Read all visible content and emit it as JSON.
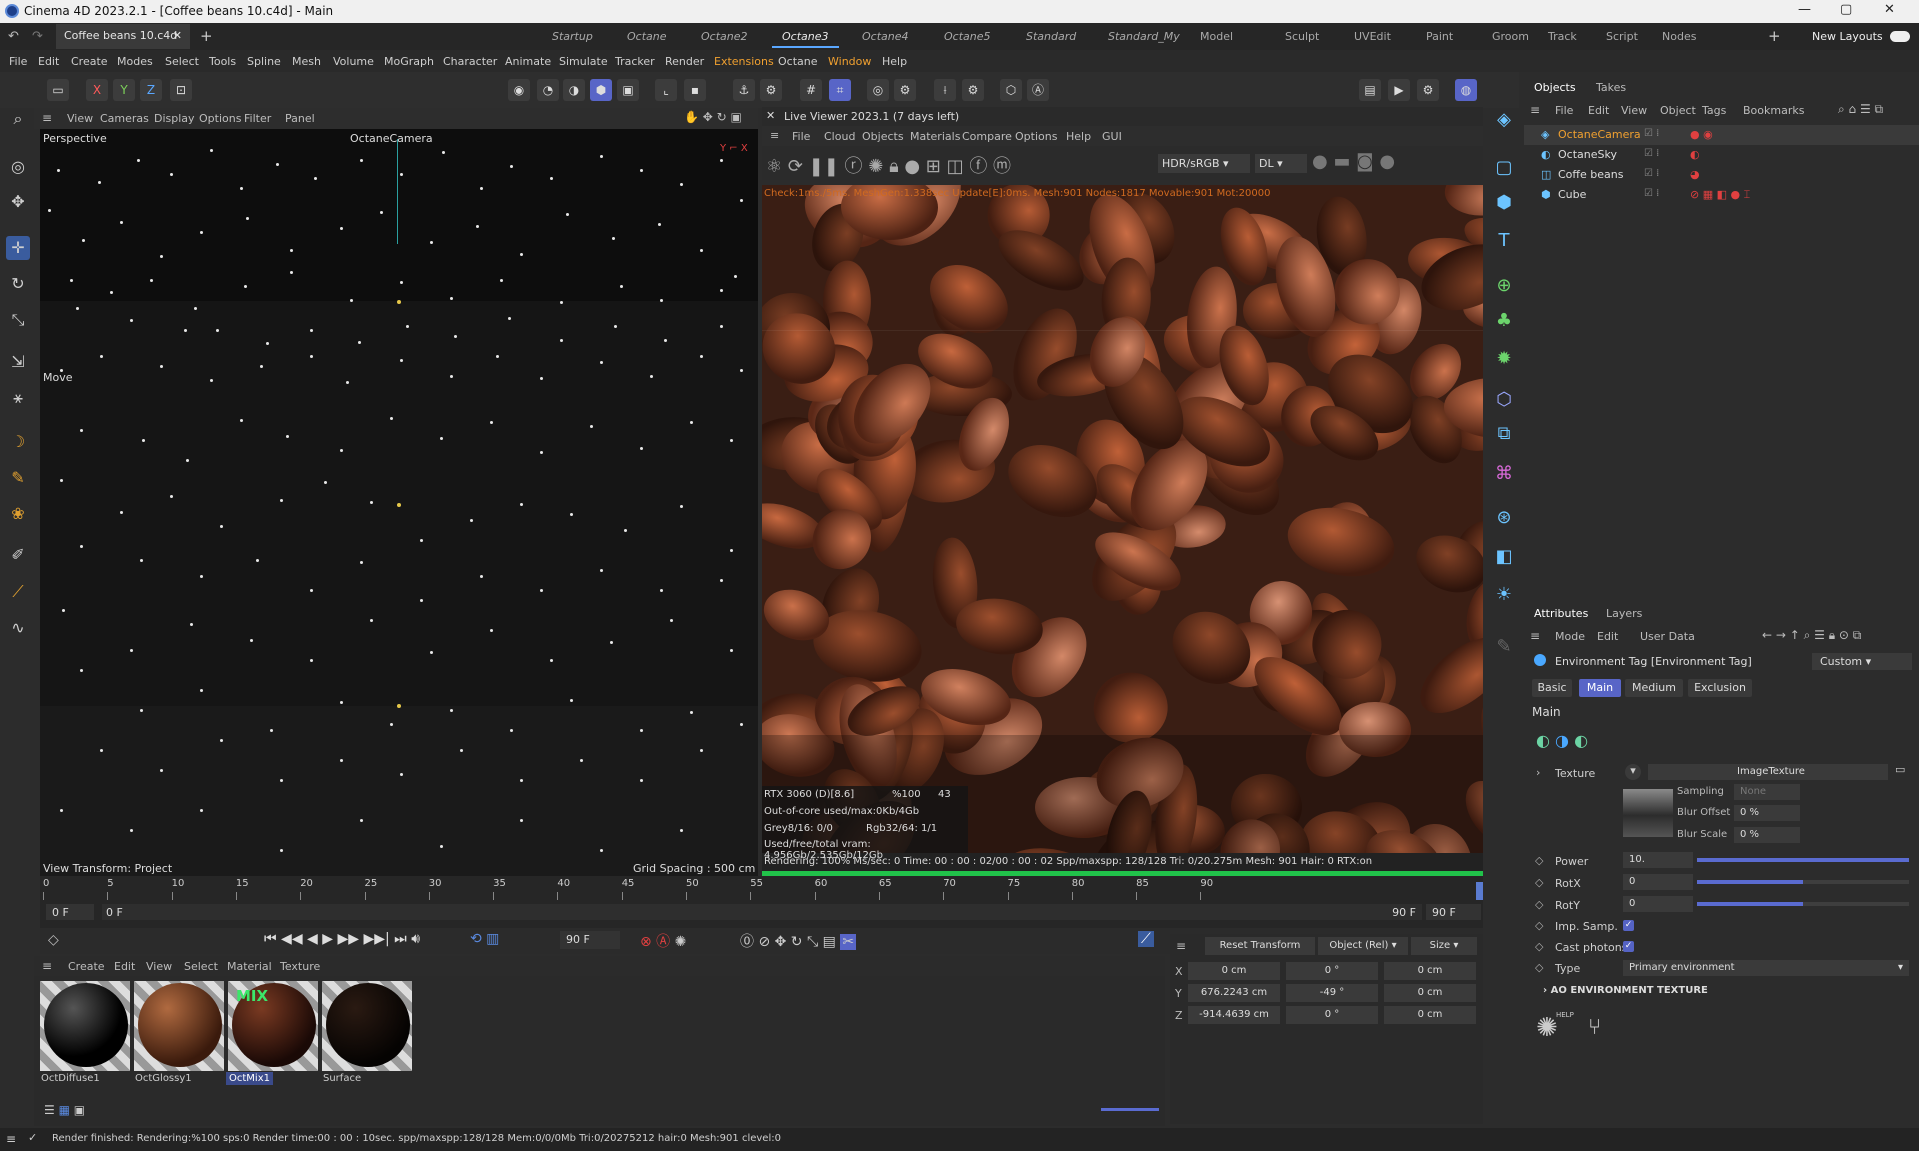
{
  "window": {
    "title": "Cinema 4D 2023.2.1 - [Coffee beans 10.c4d] - Main"
  },
  "doc_tab": "Coffee beans 10.c4d",
  "layouts": [
    "Startup",
    "Octane",
    "Octane2",
    "Octane3",
    "Octane4",
    "Octane5",
    "Standard",
    "Standard_My",
    "Model",
    "Sculpt",
    "UVEdit",
    "Paint",
    "Groom",
    "Track",
    "Script",
    "Nodes"
  ],
  "new_layouts": "New Layouts",
  "menu": [
    "File",
    "Edit",
    "Create",
    "Modes",
    "Select",
    "Tools",
    "Spline",
    "Mesh",
    "Volume",
    "MoGraph",
    "Character",
    "Animate",
    "Simulate",
    "Tracker",
    "Render",
    "Extensions",
    "Octane",
    "Window",
    "Help"
  ],
  "toolbar": {
    "x": "X",
    "y": "Y",
    "z": "Z"
  },
  "viewport": {
    "menu": [
      "View",
      "Cameras",
      "Display",
      "Options",
      "Filter",
      "Panel"
    ],
    "name": "Perspective",
    "camera": "OctaneCamera",
    "move": "Move",
    "transform": "View Transform: Project",
    "grid": "Grid Spacing : 500 cm"
  },
  "live": {
    "title": "Live Viewer 2023.1 (7 days left)",
    "menu": [
      "File",
      "Cloud",
      "Objects",
      "Materials",
      "Compare",
      "Options",
      "Help",
      "GUI"
    ],
    "hdr": "HDR/sRGB",
    "dl": "DL",
    "check": "Check:1ms./5ms. MeshGen:1.338sec Update[E]:0ms. Mesh:901 Nodes:1817 Movable:901 Mot:20000",
    "gpu": "RTX 3060 (D)[8.6]",
    "pct": "%100",
    "gpu_n": "43",
    "ooc": "Out-of-core used/max:0Kb/4Gb",
    "grey": "Grey8/16: 0/0",
    "rgb": "Rgb32/64: 1/1",
    "vram": "Used/free/total vram: 4.956Gb/2.535Gb/12Gb",
    "stats": "Rendering: 100%  Ms/sec: 0   Time: 00 : 00 : 02/00 : 00 : 02  Spp/maxspp: 128/128   Tri: 0/20.275m    Mesh: 901  Hair: 0   RTX:on",
    "progress": 1.0
  },
  "timeline": {
    "ticks": [
      "0",
      "5",
      "10",
      "15",
      "20",
      "25",
      "30",
      "35",
      "40",
      "45",
      "50",
      "55",
      "60",
      "65",
      "70",
      "75",
      "80",
      "85",
      "90"
    ],
    "start": "0 F",
    "cur": "0 F",
    "end": "90 F",
    "end2": "90 F",
    "frame": "90 F"
  },
  "material": {
    "menu": [
      "Create",
      "Edit",
      "View",
      "Select",
      "Material",
      "Texture"
    ],
    "items": [
      "OctDiffuse1",
      "OctGlossy1",
      "OctMix1",
      "Surface"
    ],
    "mix": "MIX"
  },
  "coords": {
    "reset": "Reset Transform",
    "mode": "Object (Rel)",
    "size": "Size",
    "rows": [
      {
        "axis": "X",
        "pos": "0 cm",
        "rot": "0 °",
        "sz": "0 cm"
      },
      {
        "axis": "Y",
        "pos": "676.2243 cm",
        "rot": "-49 °",
        "sz": "0 cm"
      },
      {
        "axis": "Z",
        "pos": "-914.4639 cm",
        "rot": "0 °",
        "sz": "0 cm"
      }
    ]
  },
  "objects": {
    "tabs": [
      "Objects",
      "Takes"
    ],
    "menu": [
      "File",
      "Edit",
      "View",
      "Object",
      "Tags",
      "Bookmarks"
    ],
    "items": [
      "OctaneCamera",
      "OctaneSky",
      "Coffe beans",
      "Cube"
    ]
  },
  "attributes": {
    "tabs": [
      "Attributes",
      "Layers"
    ],
    "menu": [
      "Mode",
      "Edit",
      "User Data"
    ],
    "tag": "Environment Tag [Environment Tag]",
    "preset": "Custom",
    "subtabs": [
      "Basic",
      "Main",
      "Medium",
      "Exclusion"
    ],
    "section": "Main",
    "texture_label": "Texture",
    "texture_value": "ImageTexture",
    "sampling": "Sampling",
    "sampling_val": "None",
    "blur_offset": "Blur Offset",
    "blur_offset_val": "0 %",
    "blur_scale": "Blur Scale",
    "blur_scale_val": "0 %",
    "power": "Power",
    "power_val": "10.",
    "power_level": 1.0,
    "rotx": "RotX",
    "rotx_val": "0",
    "rotx_level": 0.5,
    "roty": "RotY",
    "roty_val": "0",
    "roty_level": 0.5,
    "imp": "Imp. Samp.",
    "cast": "Cast photons",
    "type": "Type",
    "type_val": "Primary environment",
    "ao": "AO ENVIRONMENT TEXTURE",
    "help": "HELP"
  },
  "status": "Render finished: Rendering:%100 sps:0 Render time:00 : 00 : 10sec. spp/maxspp:128/128 Mem:0/0/0Mb Tri:0/20275212 hair:0 Mesh:901 clevel:0"
}
